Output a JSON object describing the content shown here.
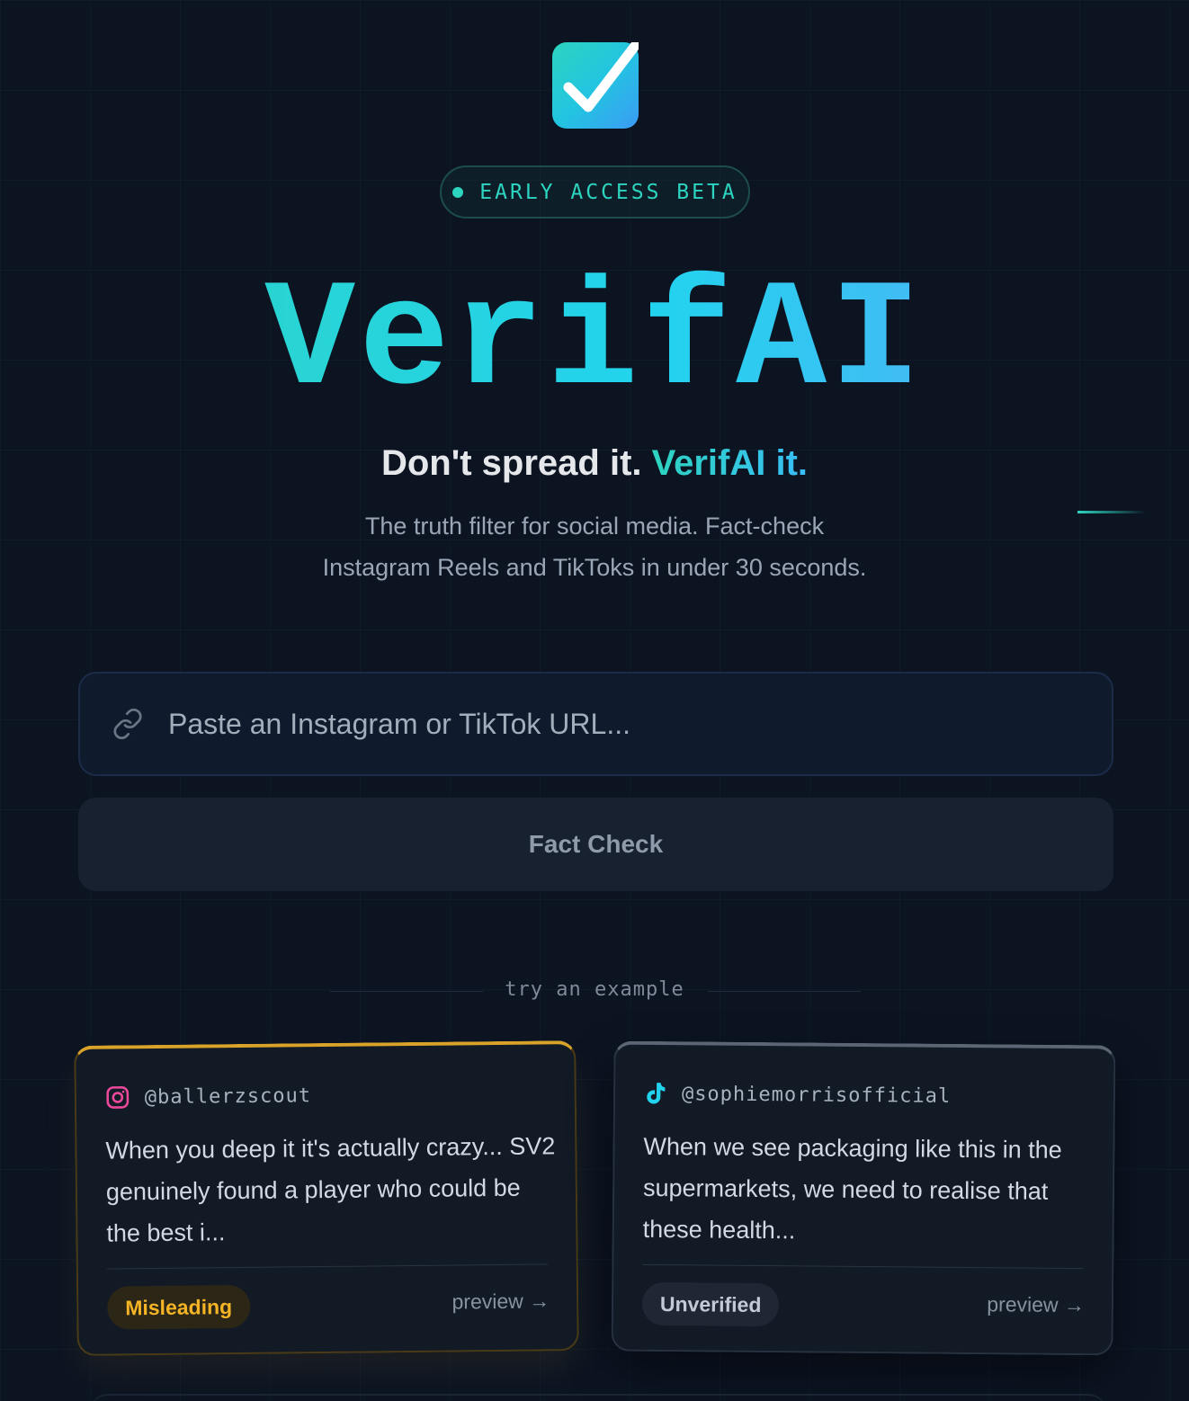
{
  "logo": {
    "icon": "checkmark-icon",
    "colors": [
      "#2dd4bf",
      "#3b9bf5"
    ]
  },
  "badge": {
    "label": "EARLY ACCESS BETA",
    "color": "#2dd4bf"
  },
  "brand": {
    "name": "VerifAI"
  },
  "tagline": {
    "lead": "Don't spread it.",
    "accent": "VerifAI it."
  },
  "subtitle": {
    "line1": "The truth filter for social media. Fact-check",
    "line2": "Instagram Reels and TikToks in under 30 seconds."
  },
  "url_input": {
    "placeholder": "Paste an Instagram or TikTok URL...",
    "value": "",
    "icon": "link-icon"
  },
  "fact_check_button": {
    "label": "Fact Check"
  },
  "examples": {
    "divider_label": "try an example",
    "cards": [
      {
        "platform": "instagram",
        "platform_icon": "instagram-icon",
        "handle": "@ballerzscout",
        "text": "When you deep it it's actually crazy... SV2 genuinely found a player who could be the best i...",
        "verdict": "Misleading",
        "verdict_color": "#f5b425",
        "preview_label": "preview →"
      },
      {
        "platform": "tiktok",
        "platform_icon": "tiktok-icon",
        "handle": "@sophiemorrisofficial",
        "text": "When we see packaging like this in the supermarkets, we need to realise that these health...",
        "verdict": "Unverified",
        "verdict_color": "#c2cad5",
        "preview_label": "preview →"
      }
    ]
  }
}
